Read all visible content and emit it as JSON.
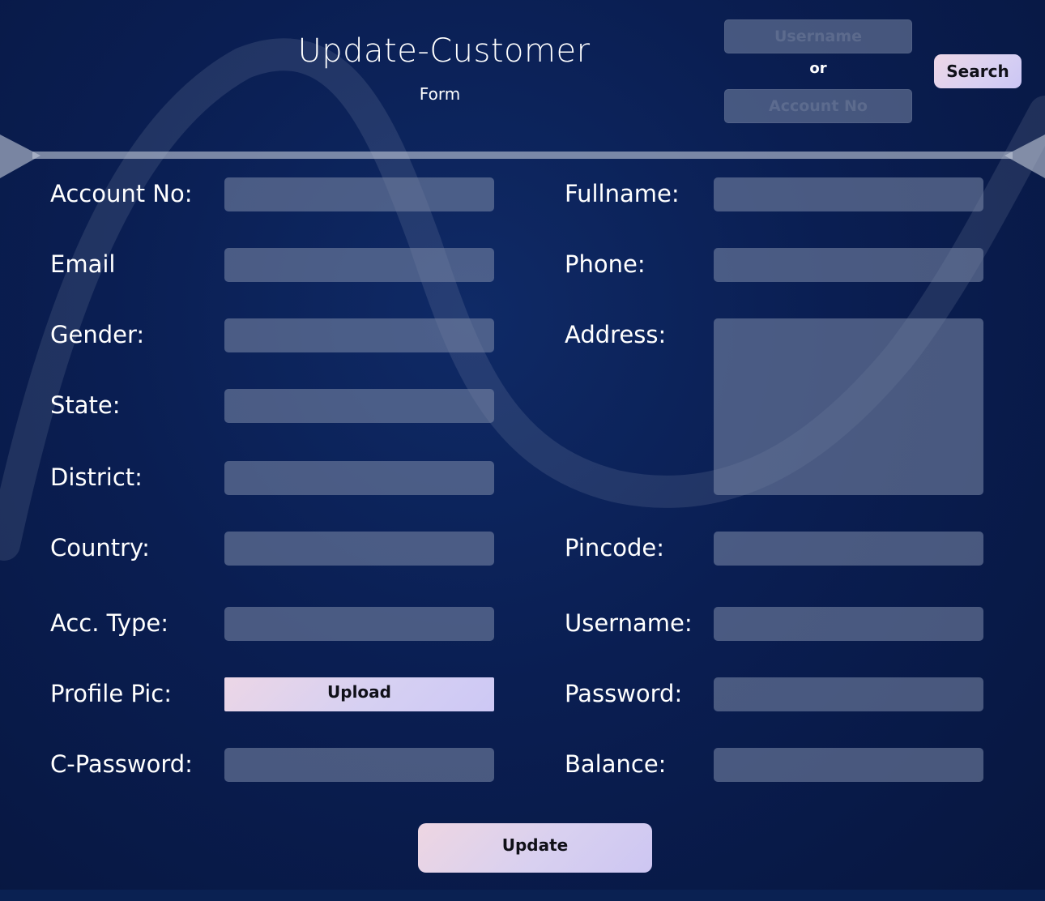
{
  "header": {
    "title": "Update-Customer",
    "subtitle": "Form"
  },
  "search": {
    "username_placeholder": "Username",
    "or_label": "or",
    "account_placeholder": "Account No",
    "button_label": "Search"
  },
  "form": {
    "account_no_label": "Account No:",
    "fullname_label": "Fullname:",
    "email_label": "Email",
    "phone_label": "Phone:",
    "gender_label": "Gender:",
    "address_label": "Address:",
    "state_label": "State:",
    "district_label": "District:",
    "country_label": "Country:",
    "pincode_label": "Pincode:",
    "acc_type_label": "Acc. Type:",
    "username_label": "Username:",
    "profile_pic_label": "Profile Pic:",
    "upload_label": "Upload",
    "password_label": "Password:",
    "c_password_label": "C-Password:",
    "balance_label": "Balance:",
    "update_label": "Update"
  },
  "colors": {
    "background": "#0a1e52",
    "field": "#6b7894",
    "button_start": "#eed6e6",
    "button_end": "#cbc6f4"
  }
}
